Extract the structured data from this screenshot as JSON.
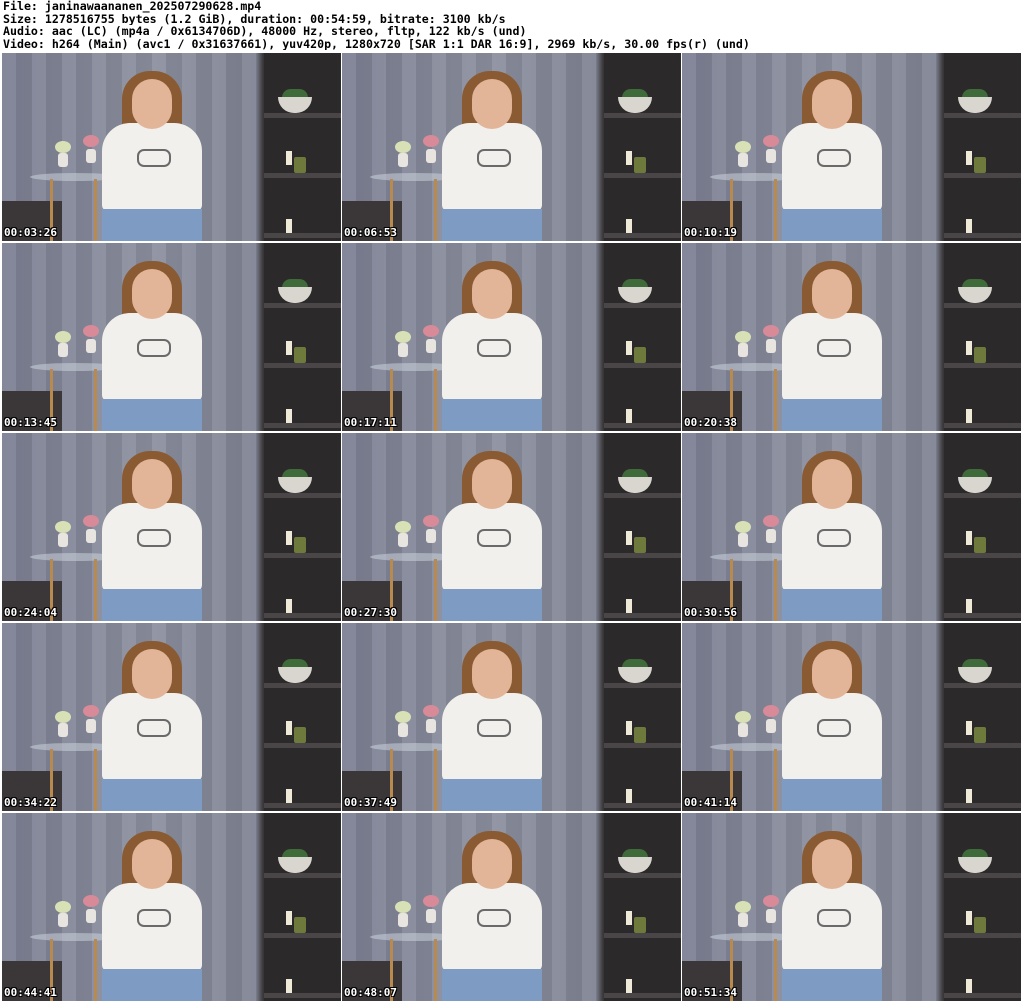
{
  "header": {
    "file": "File: janinawaananen_202507290628.mp4",
    "size": "Size: 1278516755 bytes (1.2 GiB), duration: 00:54:59, bitrate: 3100 kb/s",
    "audio": "Audio: aac (LC) (mp4a / 0x6134706D), 48000 Hz, stereo, fltp, 122 kb/s (und)",
    "video": "Video: h264 (Main) (avc1 / 0x31637661), yuv420p, 1280x720 [SAR 1:1 DAR 16:9], 2969 kb/s, 30.00 fps(r) (und)"
  },
  "thumbnails": [
    {
      "timestamp": "00:03:26"
    },
    {
      "timestamp": "00:06:53"
    },
    {
      "timestamp": "00:10:19"
    },
    {
      "timestamp": "00:13:45"
    },
    {
      "timestamp": "00:17:11"
    },
    {
      "timestamp": "00:20:38"
    },
    {
      "timestamp": "00:24:04"
    },
    {
      "timestamp": "00:27:30"
    },
    {
      "timestamp": "00:30:56"
    },
    {
      "timestamp": "00:34:22"
    },
    {
      "timestamp": "00:37:49"
    },
    {
      "timestamp": "00:41:14"
    },
    {
      "timestamp": "00:44:41"
    },
    {
      "timestamp": "00:48:07"
    },
    {
      "timestamp": "00:51:34"
    }
  ]
}
